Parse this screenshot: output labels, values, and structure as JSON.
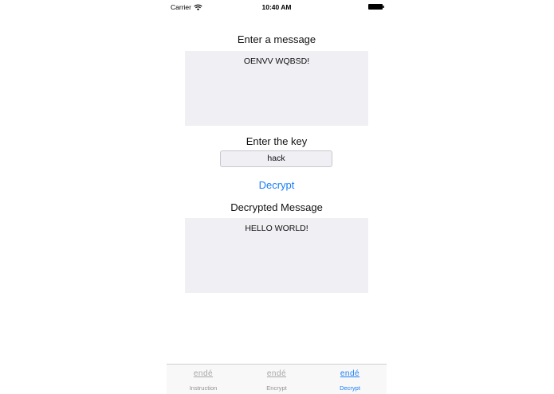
{
  "status_bar": {
    "carrier": "Carrier",
    "time": "10:40 AM"
  },
  "message_section": {
    "label": "Enter a message",
    "value": "OENVV WQBSD!"
  },
  "key_section": {
    "label": "Enter the key",
    "value": "hack"
  },
  "decrypt_button": {
    "label": "Decrypt"
  },
  "result_section": {
    "label": "Decrypted Message",
    "value": "HELLO WORLD!"
  },
  "tab_bar": {
    "tabs": [
      {
        "label": "Instruction",
        "icon_text": "endé",
        "active": false
      },
      {
        "label": "Encrypt",
        "icon_text": "endé",
        "active": false
      },
      {
        "label": "Decrypt",
        "icon_text": "endé",
        "active": true
      }
    ]
  },
  "colors": {
    "accent": "#1a7ef5",
    "field_background": "#efeff4",
    "tab_inactive": "#929292"
  }
}
